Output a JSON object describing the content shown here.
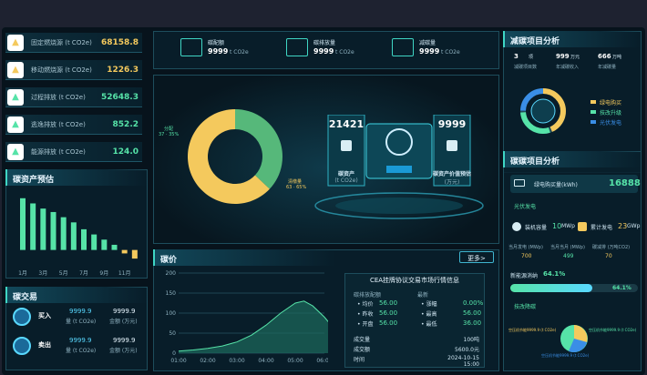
{
  "left": {
    "emissions": [
      {
        "label": "固定燃烧源 (t CO2e)",
        "value": "68158.8",
        "icon": "fire-icon",
        "color": "#f4c95d"
      },
      {
        "label": "移动燃烧源 (t CO2e)",
        "value": "1226.3",
        "icon": "fire-icon",
        "color": "#f4c95d"
      },
      {
        "label": "过程排放 (t CO2e)",
        "value": "52648.3",
        "icon": "flask-icon",
        "color": "#56e3a8"
      },
      {
        "label": "逃逸排放 (t CO2e)",
        "value": "852.2",
        "icon": "molecule-icon",
        "color": "#56e3a8"
      },
      {
        "label": "能源排放 (t CO2e)",
        "value": "124.0",
        "icon": "battery-icon",
        "color": "#56e3a8"
      }
    ],
    "forecast_title": "碳资产预估",
    "trade_title": "碳交易",
    "trade": [
      {
        "tag": "买入",
        "v1": "9999.9",
        "u1": "量 (t CO2e)",
        "v2": "9999.9",
        "u2": "金额 (万元)"
      },
      {
        "tag": "卖出",
        "v1": "9999.9",
        "u1": "量 (t CO2e)",
        "v2": "9999.9",
        "u2": "金额 (万元)"
      }
    ]
  },
  "chart_data": [
    {
      "type": "bar",
      "categories": [
        "1月",
        "2月",
        "3月",
        "4月",
        "5月",
        "6月",
        "7月",
        "8月",
        "9月",
        "10月",
        "11月",
        "12月"
      ],
      "xticks": [
        "1月",
        "3月",
        "5月",
        "7月",
        "9月",
        "11月"
      ],
      "values": [
        150,
        135,
        120,
        110,
        95,
        80,
        60,
        45,
        30,
        15,
        -10,
        -25
      ],
      "ylim": [
        -30,
        160
      ]
    },
    {
      "type": "pie",
      "title": "",
      "series": [
        {
          "name": "分配",
          "value": 37,
          "label": "37 · 35%"
        },
        {
          "name": "清缴量",
          "value": 63,
          "label": "63 · 65%"
        }
      ]
    },
    {
      "type": "area",
      "title": "碳价",
      "x": [
        "01:00",
        "02:00",
        "03:00",
        "04:00",
        "05:00",
        "06:00"
      ],
      "yticks": [
        "0",
        "50",
        "100",
        "150",
        "200"
      ],
      "ylim": [
        0,
        200
      ],
      "points": [
        [
          0,
          5
        ],
        [
          0.5,
          8
        ],
        [
          1,
          12
        ],
        [
          1.5,
          18
        ],
        [
          2,
          28
        ],
        [
          2.5,
          45
        ],
        [
          3,
          70
        ],
        [
          3.5,
          100
        ],
        [
          4,
          125
        ],
        [
          4.3,
          130
        ],
        [
          4.6,
          118
        ],
        [
          5,
          90
        ],
        [
          5.4,
          55
        ]
      ]
    }
  ],
  "center": {
    "stats": [
      {
        "label": "碳配额",
        "value": "9999",
        "unit": "t CO2e",
        "icon": "sliders-icon"
      },
      {
        "label": "碳排放量",
        "value": "9999",
        "unit": "t CO2e",
        "icon": "wind-icon"
      },
      {
        "label": "减碳量",
        "value": "9999",
        "unit": "t CO2e",
        "icon": "leaf-icon"
      }
    ],
    "asset_value": "21421",
    "asset_label": "碳资产",
    "asset_unit": "(t CO2e)",
    "asset_price_value": "9999",
    "asset_price_label": "碳资产价值预估",
    "asset_price_unit": "(万元)",
    "price_title": "碳价",
    "more": "更多>",
    "cea": {
      "title": "CEA挂牌协议交易市场行情信息",
      "left_head": "碳排放配额",
      "right_head": "最新",
      "left": [
        [
          "均价",
          "56.00"
        ],
        [
          "昨收",
          "56.00"
        ],
        [
          "开盘",
          "56.00"
        ]
      ],
      "right": [
        [
          "涨幅",
          "0.00%"
        ],
        [
          "最高",
          "56.00"
        ],
        [
          "最低",
          "36.00"
        ]
      ],
      "foot": [
        [
          "成交量",
          "100吨"
        ],
        [
          "成交额",
          "5600.0元"
        ],
        [
          "时间",
          "2024-10-15 15:00"
        ]
      ]
    }
  },
  "right": {
    "reduce_title": "减碳项目分析",
    "reduce_stats": [
      {
        "value": "3",
        "unit": "项",
        "label": "减碳项目数"
      },
      {
        "value": "999",
        "unit": "万元",
        "label": "年减碳收入"
      },
      {
        "value": "666",
        "unit": "万吨",
        "label": "年减碳量"
      }
    ],
    "legend": [
      "绿电购买",
      "技改升级",
      "光伏发电"
    ],
    "carbon_title": "碳碳项目分析",
    "green_label": "绿电购买量(kWh)",
    "green_value": "16888",
    "pv_label": "光伏发电",
    "installed_label": "装机容量",
    "installed_value": "10",
    "installed_unit": "MWp",
    "cum_label": "累计发电",
    "cum_value": "23",
    "cum_unit": "GWp",
    "month_cols": [
      {
        "label": "当月发电 (MWp)",
        "value": "700"
      },
      {
        "label": "当月当月 (MWp)",
        "value": "499"
      },
      {
        "label": "碳减排 (万吨CO2)",
        "value": "70"
      }
    ],
    "new_energy_label": "新能源消纳",
    "new_energy_value": "64.1%",
    "progress": 0.641,
    "tech_label": "技改降碳",
    "pie_labels": [
      "空压机节能9999.9 (t CO2e)",
      "空压机节能9999.9 (t CO2e)",
      "空压机节能9999.9 (t CO2e)"
    ]
  }
}
